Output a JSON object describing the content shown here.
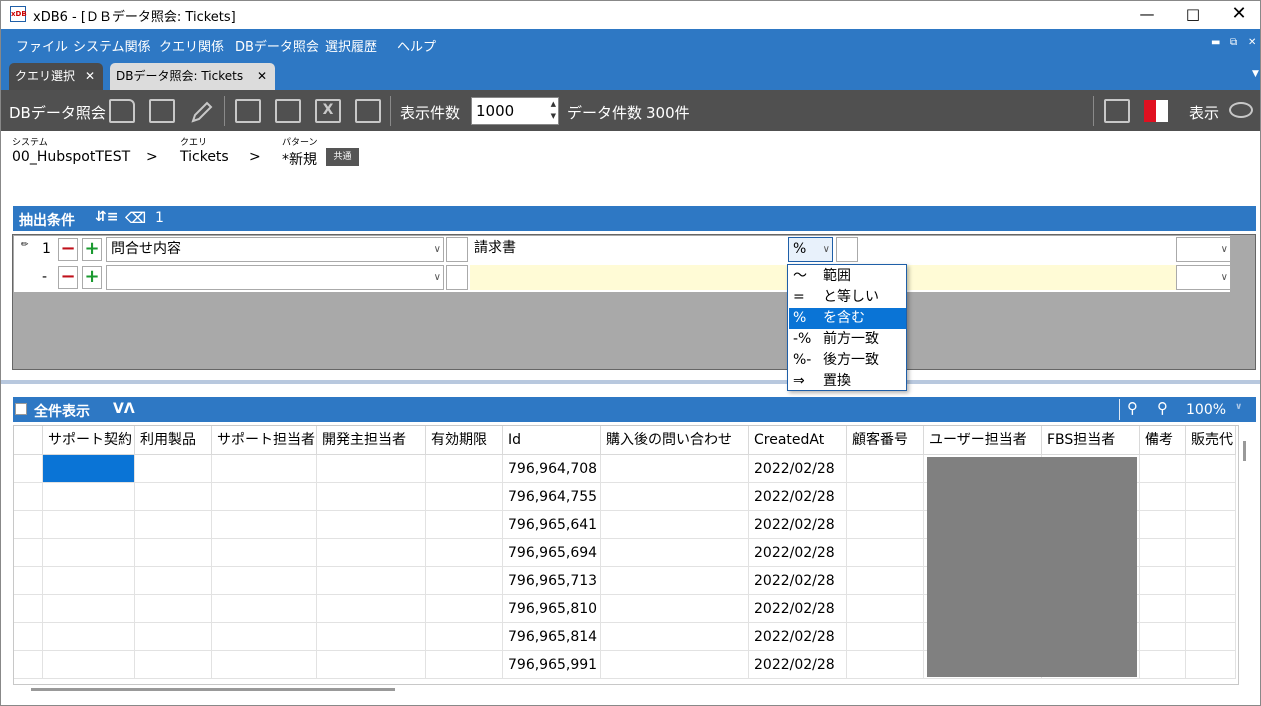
{
  "window": {
    "app_badge": "xDB",
    "title": "xDB6 - [ＤＢデータ照会: Tickets]"
  },
  "menu": [
    "ファイル",
    "システム関係",
    "クエリ関係",
    "DBデータ照会",
    "選択履歴",
    "ヘルプ"
  ],
  "tabs": [
    {
      "label": "クエリ選択",
      "active": false
    },
    {
      "label": "DBデータ照会: Tickets",
      "active": true
    }
  ],
  "toolbar": {
    "title": "DBデータ照会",
    "display_count_label": "表示件数",
    "display_count_value": "1000",
    "data_count_label": "データ件数",
    "data_count_value": "300件",
    "display_label": "表示"
  },
  "breadcrumb": {
    "system_label": "システム",
    "system_value": "00_HubspotTEST",
    "query_label": "クエリ",
    "query_value": "Tickets",
    "pattern_label": "パターン",
    "pattern_value": "*新規",
    "shared_badge": "共通",
    "separator": ">"
  },
  "conditions": {
    "title": "抽出条件",
    "count": "1",
    "rows": [
      {
        "index": "1",
        "field": "問合せ内容",
        "value": "請求書",
        "operator": "%"
      },
      {
        "index": "-",
        "field": "",
        "value": "",
        "operator": ""
      }
    ],
    "operator_options": [
      {
        "symbol": "～",
        "label": "範囲"
      },
      {
        "symbol": "=",
        "label": "と等しい"
      },
      {
        "symbol": "%",
        "label": "を含む"
      },
      {
        "symbol": "-%",
        "label": "前方一致"
      },
      {
        "symbol": "%-",
        "label": "後方一致"
      },
      {
        "symbol": "⇒",
        "label": "置換"
      }
    ],
    "selected_operator": "を含む"
  },
  "results": {
    "show_all_label": "全件表示",
    "zoom": "100%",
    "columns": [
      "サポート契約",
      "利用製品",
      "サポート担当者",
      "開発主担当者",
      "有効期限",
      "Id",
      "購入後の問い合わせ",
      "CreatedAt",
      "顧客番号",
      "ユーザー担当者",
      "FBS担当者",
      "備考",
      "販売代"
    ],
    "rows": [
      {
        "id": "796,964,708",
        "created_at": "2022/02/28"
      },
      {
        "id": "796,964,755",
        "created_at": "2022/02/28"
      },
      {
        "id": "796,965,641",
        "created_at": "2022/02/28"
      },
      {
        "id": "796,965,694",
        "created_at": "2022/02/28"
      },
      {
        "id": "796,965,713",
        "created_at": "2022/02/28"
      },
      {
        "id": "796,965,810",
        "created_at": "2022/02/28"
      },
      {
        "id": "796,965,814",
        "created_at": "2022/02/28"
      },
      {
        "id": "796,965,991",
        "created_at": "2022/02/28"
      }
    ]
  },
  "colors": {
    "accent": "#2e78c4",
    "toolbar": "#505050",
    "selection": "#0a74d6"
  }
}
